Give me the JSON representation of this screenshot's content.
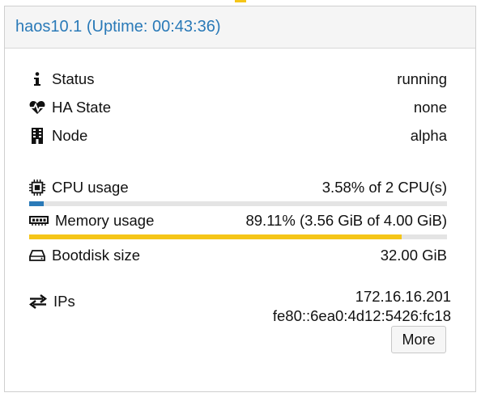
{
  "header": {
    "title": "haos10.1 (Uptime: 00:43:36)"
  },
  "status": {
    "label": "Status",
    "value": "running",
    "icon": "info-icon"
  },
  "ha_state": {
    "label": "HA State",
    "value": "none",
    "icon": "heartbeat-icon"
  },
  "node": {
    "label": "Node",
    "value": "alpha",
    "icon": "building-icon"
  },
  "cpu": {
    "label": "CPU usage",
    "value": "3.58% of 2 CPU(s)",
    "icon": "cpu-icon",
    "fraction": 0.0358
  },
  "memory": {
    "label": "Memory usage",
    "value": "89.11% (3.56 GiB of 4.00 GiB)",
    "icon": "memory-icon",
    "fraction": 0.8911,
    "bar_color": "#f5c518"
  },
  "bootdisk": {
    "label": "Bootdisk size",
    "value": "32.00 GiB",
    "icon": "hdd-icon"
  },
  "ips": {
    "label": "IPs",
    "icon": "exchange-icon",
    "values": [
      "172.16.16.201",
      "fe80::6ea0:4d12:5426:fc18"
    ]
  },
  "more_button": {
    "label": "More"
  },
  "colors": {
    "accent": "#f5c518",
    "title": "#2a7ab8",
    "bar_track": "#e4e4e4",
    "cpu_bar": "#2a7ab8"
  }
}
